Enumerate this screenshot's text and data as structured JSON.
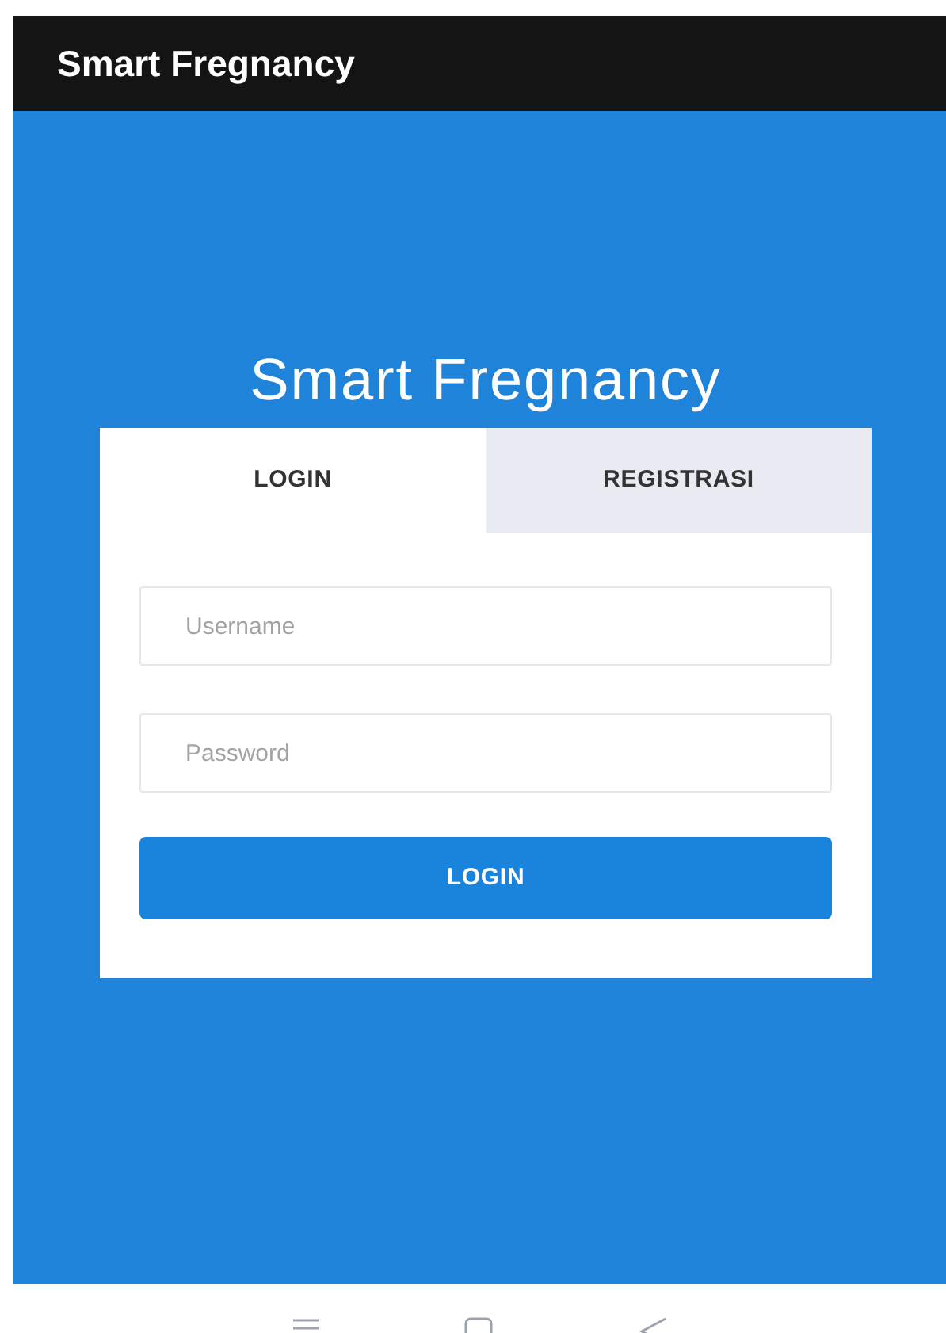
{
  "app_bar": {
    "title": "Smart Fregnancy"
  },
  "heading": "Smart Fregnancy",
  "tabs": [
    {
      "label": "LOGIN",
      "selected": true
    },
    {
      "label": "REGISTRASI",
      "selected": false
    }
  ],
  "fields": [
    {
      "placeholder": "Username"
    },
    {
      "placeholder": "Password"
    }
  ],
  "submit_button": "LOGIN"
}
